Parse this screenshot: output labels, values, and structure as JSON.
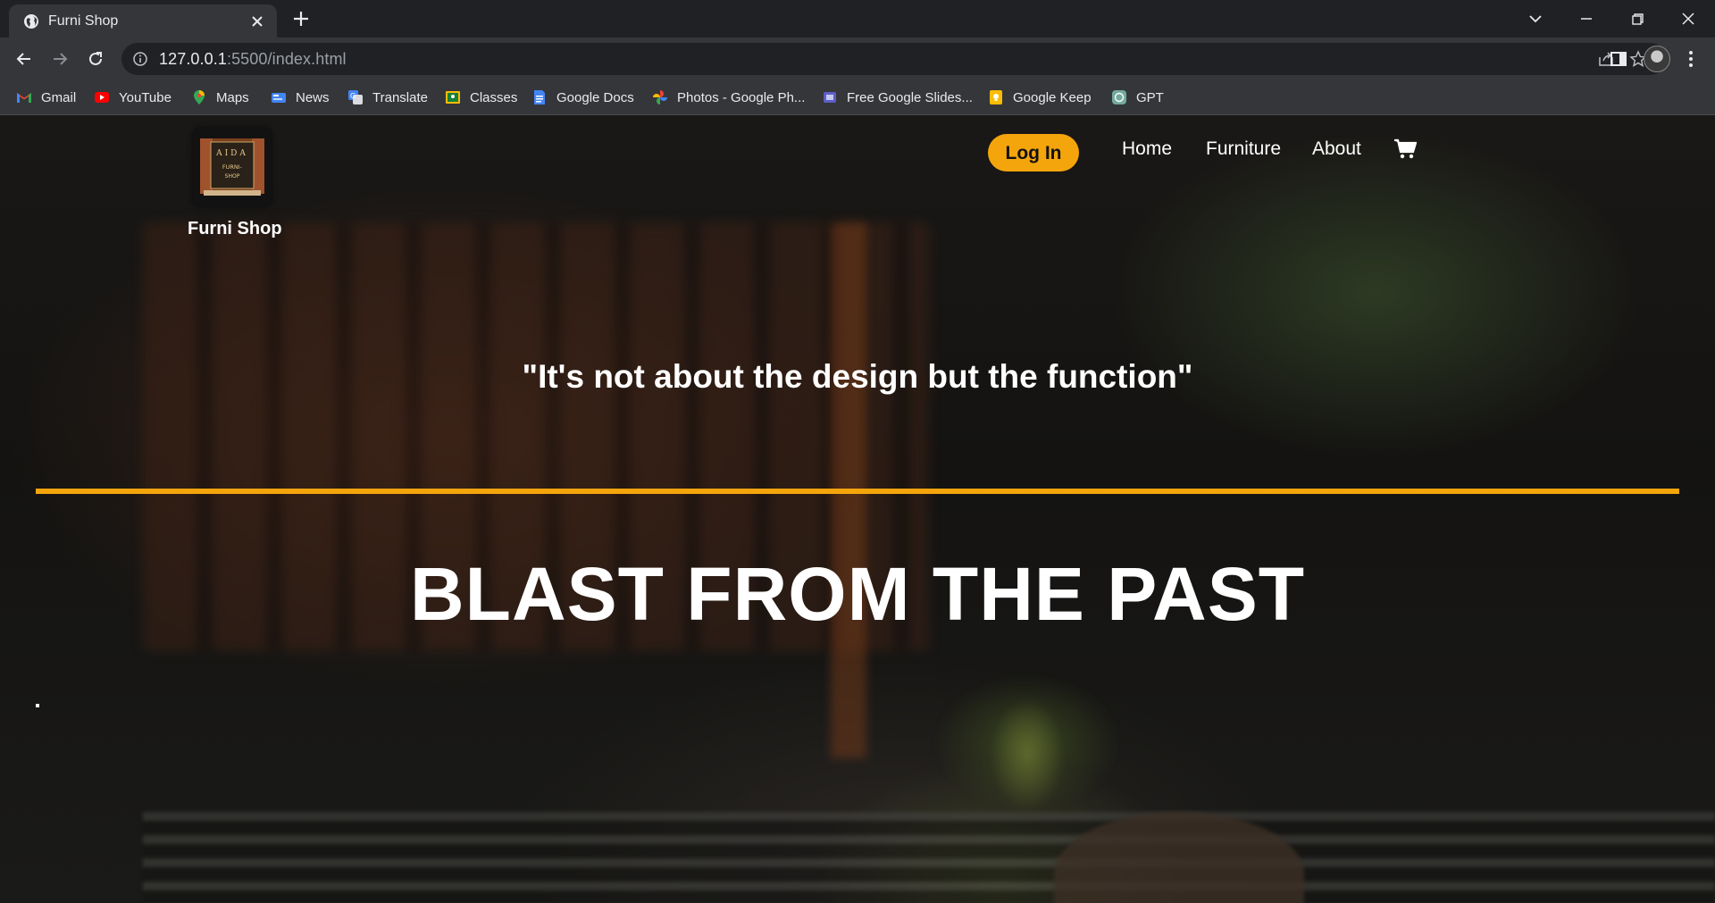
{
  "browser": {
    "tab_title": "Furni Shop",
    "url_host": "127.0.0.1",
    "url_rest": ":5500/index.html",
    "bookmarks": [
      {
        "label": "Gmail",
        "icon": "gmail-icon"
      },
      {
        "label": "YouTube",
        "icon": "youtube-icon"
      },
      {
        "label": "Maps",
        "icon": "maps-icon"
      },
      {
        "label": "News",
        "icon": "news-icon"
      },
      {
        "label": "Translate",
        "icon": "translate-icon"
      },
      {
        "label": "Classes",
        "icon": "classes-icon"
      },
      {
        "label": "Google Docs",
        "icon": "docs-icon"
      },
      {
        "label": "Photos - Google Ph...",
        "icon": "photos-icon"
      },
      {
        "label": "Free Google Slides...",
        "icon": "slides-icon"
      },
      {
        "label": "Google Keep",
        "icon": "keep-icon"
      },
      {
        "label": "GPT",
        "icon": "gpt-icon"
      }
    ]
  },
  "site": {
    "logo_text_top": "AIDA",
    "logo_text_mid": "FURNI-",
    "logo_text_bot": "SHOP",
    "brand": "Furni Shop",
    "login_label": "Log In",
    "nav": [
      "Home",
      "Furniture",
      "About"
    ],
    "quote": "\"It's not about the design but the function\"",
    "headline": "BLAST FROM THE PAST"
  },
  "colors": {
    "accent": "#f5a50c",
    "chrome_dark": "#202124",
    "chrome_mid": "#35363a"
  }
}
